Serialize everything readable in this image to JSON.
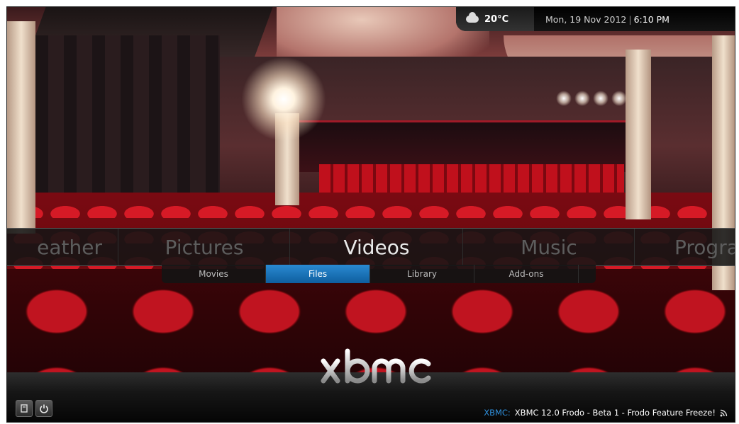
{
  "topbar": {
    "temperature": "20°C",
    "date": "Mon, 19 Nov 2012",
    "time": "6:10 PM",
    "weather_icon": "cloud-icon"
  },
  "main_menu": {
    "items": [
      "eather",
      "Pictures",
      "Videos",
      "Music",
      "Progra"
    ],
    "active": "Videos"
  },
  "sub_menu": {
    "items": [
      "Movies",
      "Files",
      "Library",
      "Add-ons"
    ],
    "active": "Files"
  },
  "logo_text": "xbmc",
  "bottom": {
    "buttons": [
      "favourites-icon",
      "power-icon"
    ],
    "ticker_source": "XBMC:",
    "ticker_text": "XBMC 12.0 Frodo - Beta 1 - Frodo Feature Freeze!",
    "rss_icon": "rss-icon"
  },
  "colors": {
    "accent": "#2a8ad2",
    "ticker_source": "#2f8fdb"
  }
}
